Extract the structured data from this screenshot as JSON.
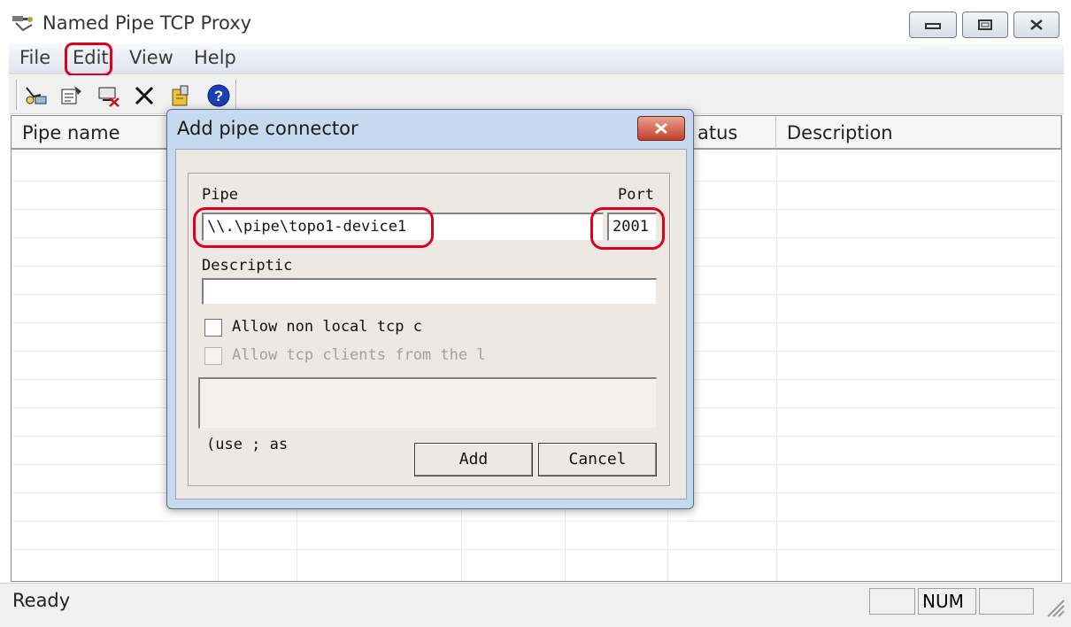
{
  "window": {
    "title": "Named Pipe TCP Proxy",
    "icon": "pipe-proxy-app-icon",
    "controls": [
      "minimize",
      "maximize",
      "close"
    ]
  },
  "menu": [
    "File",
    "Edit",
    "View",
    "Help"
  ],
  "toolbar": [
    "add-pipe-icon",
    "properties-icon",
    "remove-connection-icon",
    "delete-x-icon",
    "tools-icon",
    "help-question-icon"
  ],
  "list": {
    "headers": [
      "Pipe name",
      "Status",
      "Description"
    ],
    "visible_headers": {
      "pipe_name": "Pipe name",
      "status_partial": "atus",
      "description": "Description"
    },
    "rows": []
  },
  "statusbar": {
    "text": "Ready",
    "indicators": [
      "",
      "NUM",
      ""
    ]
  },
  "dialog": {
    "title": "Add pipe connector",
    "pipe_label": "Pipe",
    "pipe_value": "\\\\.\\pipe\\topo1-device1",
    "port_label": "Port",
    "port_value": "2001",
    "description_label": "Descriptic",
    "description_value": "",
    "checkbox1_label": "Allow non local tcp c",
    "checkbox1_checked": false,
    "checkbox2_label": "Allow tcp clients from the l",
    "checkbox2_checked": false,
    "checkbox2_enabled": false,
    "allowed_clients_value": "",
    "hint": "(use ; as",
    "add_label": "Add",
    "cancel_label": "Cancel"
  },
  "colors": {
    "highlight": "#e0001b",
    "dialog_frame": "#c6d9ef",
    "close_button": "#c4402b"
  }
}
